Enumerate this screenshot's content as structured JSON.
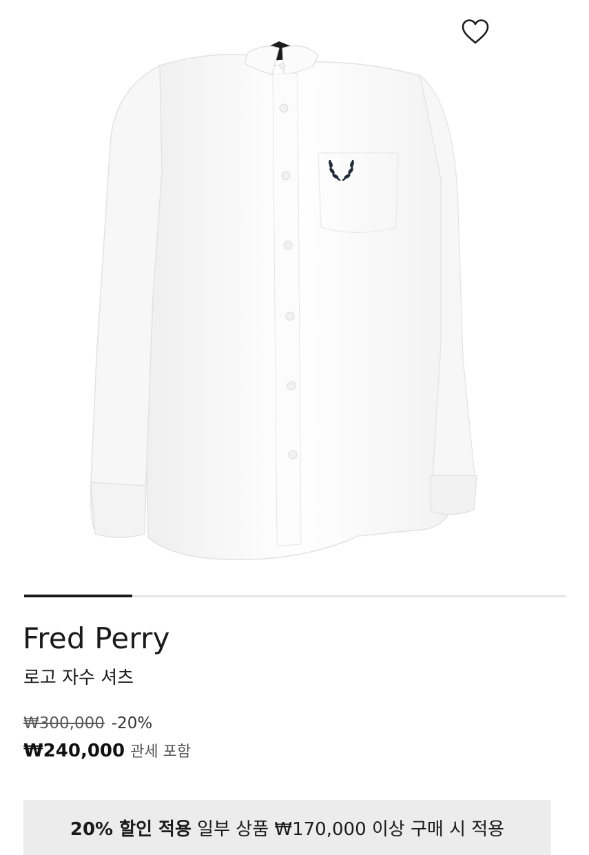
{
  "gallery": {
    "image_subject": "white long-sleeve button-down shirt with laurel wreath logo",
    "wishlist_icon": "heart-outline-icon",
    "progress_fraction": 0.2
  },
  "product": {
    "brand": "Fred Perry",
    "name": "로고 자수 셔츠"
  },
  "pricing": {
    "original_price": "₩300,000",
    "discount": "-20%",
    "sale_price": "₩240,000",
    "tax_note": "관세 포함"
  },
  "promo": {
    "highlight": "20% 할인 적용",
    "detail": "일부 상품 ₩170,000 이상 구매 시 적용"
  },
  "colors": {
    "text": "#1a1a1a",
    "banner_bg": "#ececec",
    "progress_active": "#1a1a1a",
    "progress_track": "#e4e4e4",
    "logo": "#1f2a3a"
  }
}
